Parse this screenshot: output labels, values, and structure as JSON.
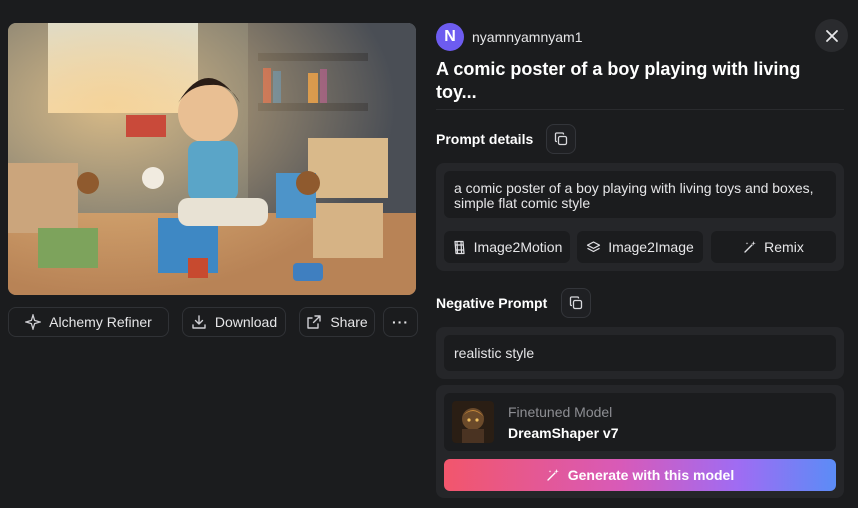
{
  "image": {
    "alt": "comic poster of a boy playing with living toys"
  },
  "image_actions": {
    "alchemy_refiner": "Alchemy Refiner",
    "download": "Download",
    "share": "Share",
    "more": "···"
  },
  "user": {
    "avatar_letter": "N",
    "name": "nyamnyamnyam1"
  },
  "title": "A comic poster of a boy playing with living toy...",
  "prompt_details": {
    "label": "Prompt details",
    "text": "a comic poster of a boy playing with living toys and boxes, simple flat comic style"
  },
  "actions": {
    "image2motion": "Image2Motion",
    "image2image": "Image2Image",
    "remix": "Remix"
  },
  "negative_prompt": {
    "label": "Negative Prompt",
    "text": "realistic style"
  },
  "model": {
    "type_label": "Finetuned Model",
    "name": "DreamShaper v7"
  },
  "generate_button": "Generate with this model",
  "colors": {
    "background": "#1b1c1e",
    "panel": "#252629",
    "avatar": "#6d5cf0",
    "gradient_start": "#f2566c",
    "gradient_end": "#5b8cf6"
  }
}
